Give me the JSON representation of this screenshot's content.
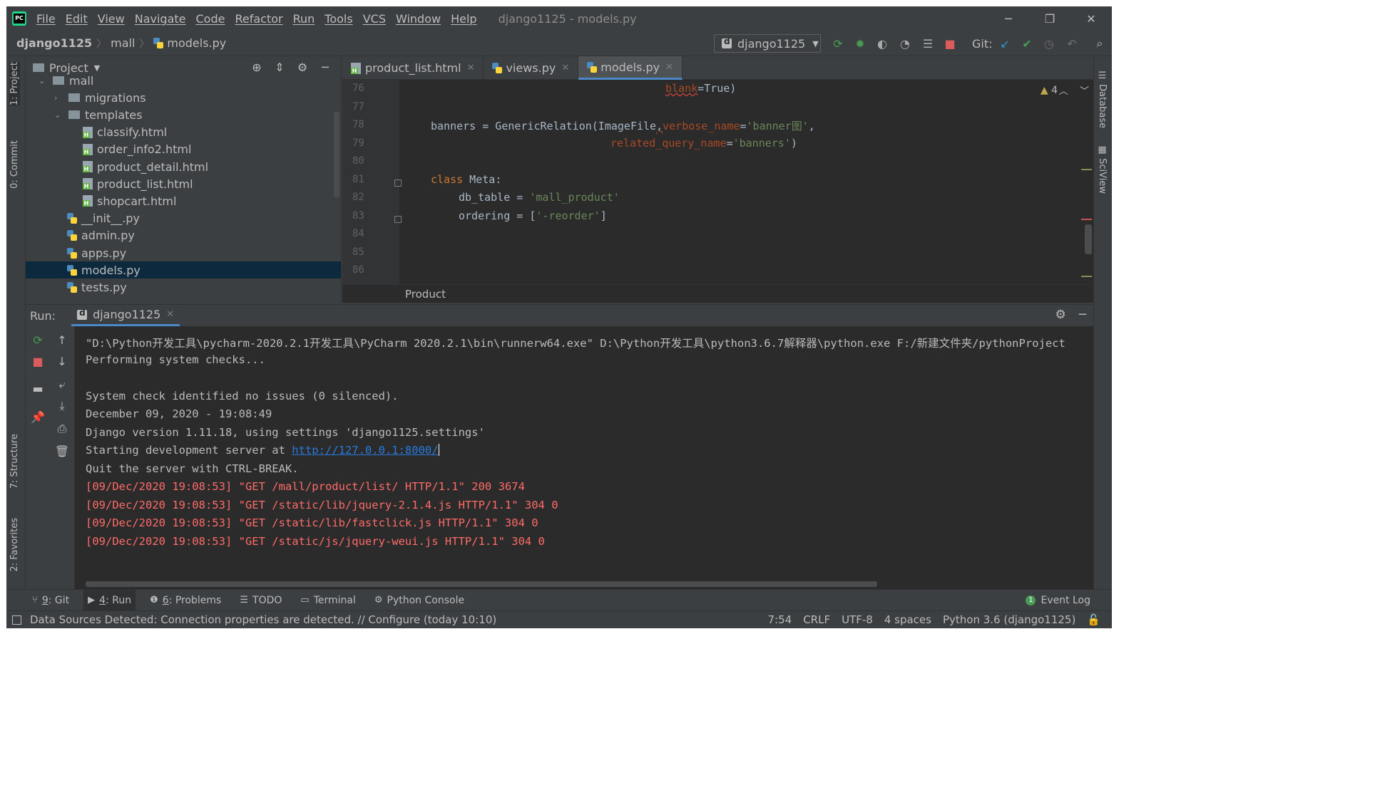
{
  "menu": [
    "File",
    "Edit",
    "View",
    "Navigate",
    "Code",
    "Refactor",
    "Run",
    "Tools",
    "VCS",
    "Window",
    "Help"
  ],
  "window_title": "django1125 - models.py",
  "breadcrumb": [
    "django1125",
    "mall",
    "models.py"
  ],
  "run_config": "django1125",
  "git_label": "Git:",
  "project_panel": {
    "title": "Project",
    "items": [
      {
        "label": "mall",
        "indent": 1,
        "kind": "folder",
        "open": true
      },
      {
        "label": "migrations",
        "indent": 2,
        "kind": "folder",
        "open": false
      },
      {
        "label": "templates",
        "indent": 2,
        "kind": "folder",
        "open": true
      },
      {
        "label": "classify.html",
        "indent": 3,
        "kind": "html"
      },
      {
        "label": "order_info2.html",
        "indent": 3,
        "kind": "html"
      },
      {
        "label": "product_detail.html",
        "indent": 3,
        "kind": "html"
      },
      {
        "label": "product_list.html",
        "indent": 3,
        "kind": "html"
      },
      {
        "label": "shopcart.html",
        "indent": 3,
        "kind": "html"
      },
      {
        "label": "__init__.py",
        "indent": 2,
        "kind": "py"
      },
      {
        "label": "admin.py",
        "indent": 2,
        "kind": "py"
      },
      {
        "label": "apps.py",
        "indent": 2,
        "kind": "py"
      },
      {
        "label": "models.py",
        "indent": 2,
        "kind": "py",
        "selected": true
      },
      {
        "label": "tests.py",
        "indent": 2,
        "kind": "py"
      }
    ]
  },
  "editor": {
    "tabs": [
      {
        "label": "product_list.html",
        "kind": "html"
      },
      {
        "label": "views.py",
        "kind": "py"
      },
      {
        "label": "models.py",
        "kind": "py",
        "active": true
      }
    ],
    "line_numbers": [
      "76",
      "77",
      "78",
      "79",
      "80",
      "81",
      "82",
      "83",
      "84",
      "85",
      "86"
    ],
    "warnings_count": "4",
    "structure_breadcrumb": "Product",
    "code": {
      "l76_param": "blank",
      "l76_rest": "=True)",
      "l78_a": "banners = GenericRelation(ImageFile",
      "l78_comma": ",",
      "l78_param": "verbose_name",
      "l78_eq": "=",
      "l78_str": "'banner图'",
      "l78_end": ",",
      "l79_param": "related_query_name",
      "l79_eq": "=",
      "l79_str": "'banners'",
      "l79_end": ")",
      "l81_kw": "class",
      "l81_rest": " Meta:",
      "l82_a": "db_table = ",
      "l82_str": "'mall_product'",
      "l83_a": "ordering = [",
      "l83_str": "'-reorder'",
      "l83_end": "]"
    }
  },
  "run_panel": {
    "label": "Run:",
    "tab": "django1125",
    "console": {
      "cmd": "\"D:\\Python开发工具\\pycharm-2020.2.1开发工具\\PyCharm 2020.2.1\\bin\\runnerw64.exe\" D:\\Python开发工具\\python3.6.7解释器\\python.exe F:/新建文件夹/pythonProject",
      "checks": "Performing system checks...",
      "no_issues": "System check identified no issues (0 silenced).",
      "date": "December 09, 2020 - 19:08:49",
      "django_version": "Django version 1.11.18, using settings 'django1125.settings'",
      "starting": "Starting development server at ",
      "url": "http://127.0.0.1:8000/",
      "quit": "Quit the server with CTRL-BREAK.",
      "log1": "[09/Dec/2020 19:08:53] \"GET /mall/product/list/ HTTP/1.1\" 200 3674",
      "log2": "[09/Dec/2020 19:08:53] \"GET /static/lib/jquery-2.1.4.js HTTP/1.1\" 304 0",
      "log3": "[09/Dec/2020 19:08:53] \"GET /static/lib/fastclick.js HTTP/1.1\" 304 0",
      "log4": "[09/Dec/2020 19:08:53] \"GET /static/js/jquery-weui.js HTTP/1.1\" 304 0"
    }
  },
  "left_tabs": {
    "project": "1: Project",
    "commit": "0: Commit",
    "structure": "7: Structure",
    "favorites": "2: Favorites"
  },
  "right_tabs": {
    "database": "Database",
    "sciview": "SciView"
  },
  "tool_windows": [
    {
      "num": "9",
      "label": ": Git",
      "icon": "git-icon"
    },
    {
      "num": "4",
      "label": ": Run",
      "icon": "run-icon",
      "active": true
    },
    {
      "num": "6",
      "label": ": Problems",
      "icon": "problems-icon"
    },
    {
      "num": "",
      "label": "TODO",
      "icon": "todo-icon"
    },
    {
      "num": "",
      "label": "Terminal",
      "icon": "terminal-icon"
    },
    {
      "num": "",
      "label": "Python Console",
      "icon": "python-console-icon"
    }
  ],
  "event_log": {
    "count": "1",
    "label": "Event Log"
  },
  "status": {
    "message": "Data Sources Detected: Connection properties are detected. // Configure (today 10:10)",
    "position": "7:54",
    "line_sep": "CRLF",
    "encoding": "UTF-8",
    "indent": "4 spaces",
    "interpreter": "Python 3.6 (django1125)"
  },
  "colors": {
    "accent": "#4a88c7",
    "error_red": "#ff6b68",
    "link": "#287bde",
    "keyword": "#cc7832",
    "string": "#6a8759"
  }
}
